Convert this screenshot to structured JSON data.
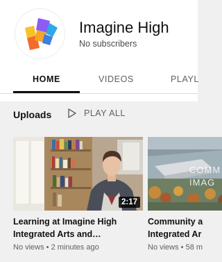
{
  "channel": {
    "name": "Imagine High",
    "subscribers": "No subscribers"
  },
  "tabs": [
    {
      "label": "HOME",
      "active": true
    },
    {
      "label": "VIDEOS",
      "active": false
    },
    {
      "label": "PLAYL",
      "active": false
    }
  ],
  "section": {
    "title": "Uploads",
    "play_all_label": "PLAY ALL"
  },
  "videos": [
    {
      "title_line1": "Learning at Imagine High",
      "title_line2": "Integrated Arts and…",
      "views": "No views",
      "age": "2 minutes ago",
      "meta": "No views • 2 minutes ago",
      "duration": "2:17"
    },
    {
      "title_line1": "Community a",
      "title_line2": "Integrated Ar",
      "views": "No views",
      "age": "58 m",
      "meta": "No views • 58 m",
      "thumbnail_overlay_text_1": "COMM",
      "thumbnail_overlay_text_2": "IMAG"
    }
  ],
  "colors": {
    "accent": "#0f0f0f",
    "secondary_text": "#606060",
    "background": "#f0f0f0",
    "logo_purple": "#8b5cf6",
    "logo_blue": "#2ea8e8",
    "logo_yellow": "#f6c12a",
    "logo_orange": "#f26c2b"
  }
}
